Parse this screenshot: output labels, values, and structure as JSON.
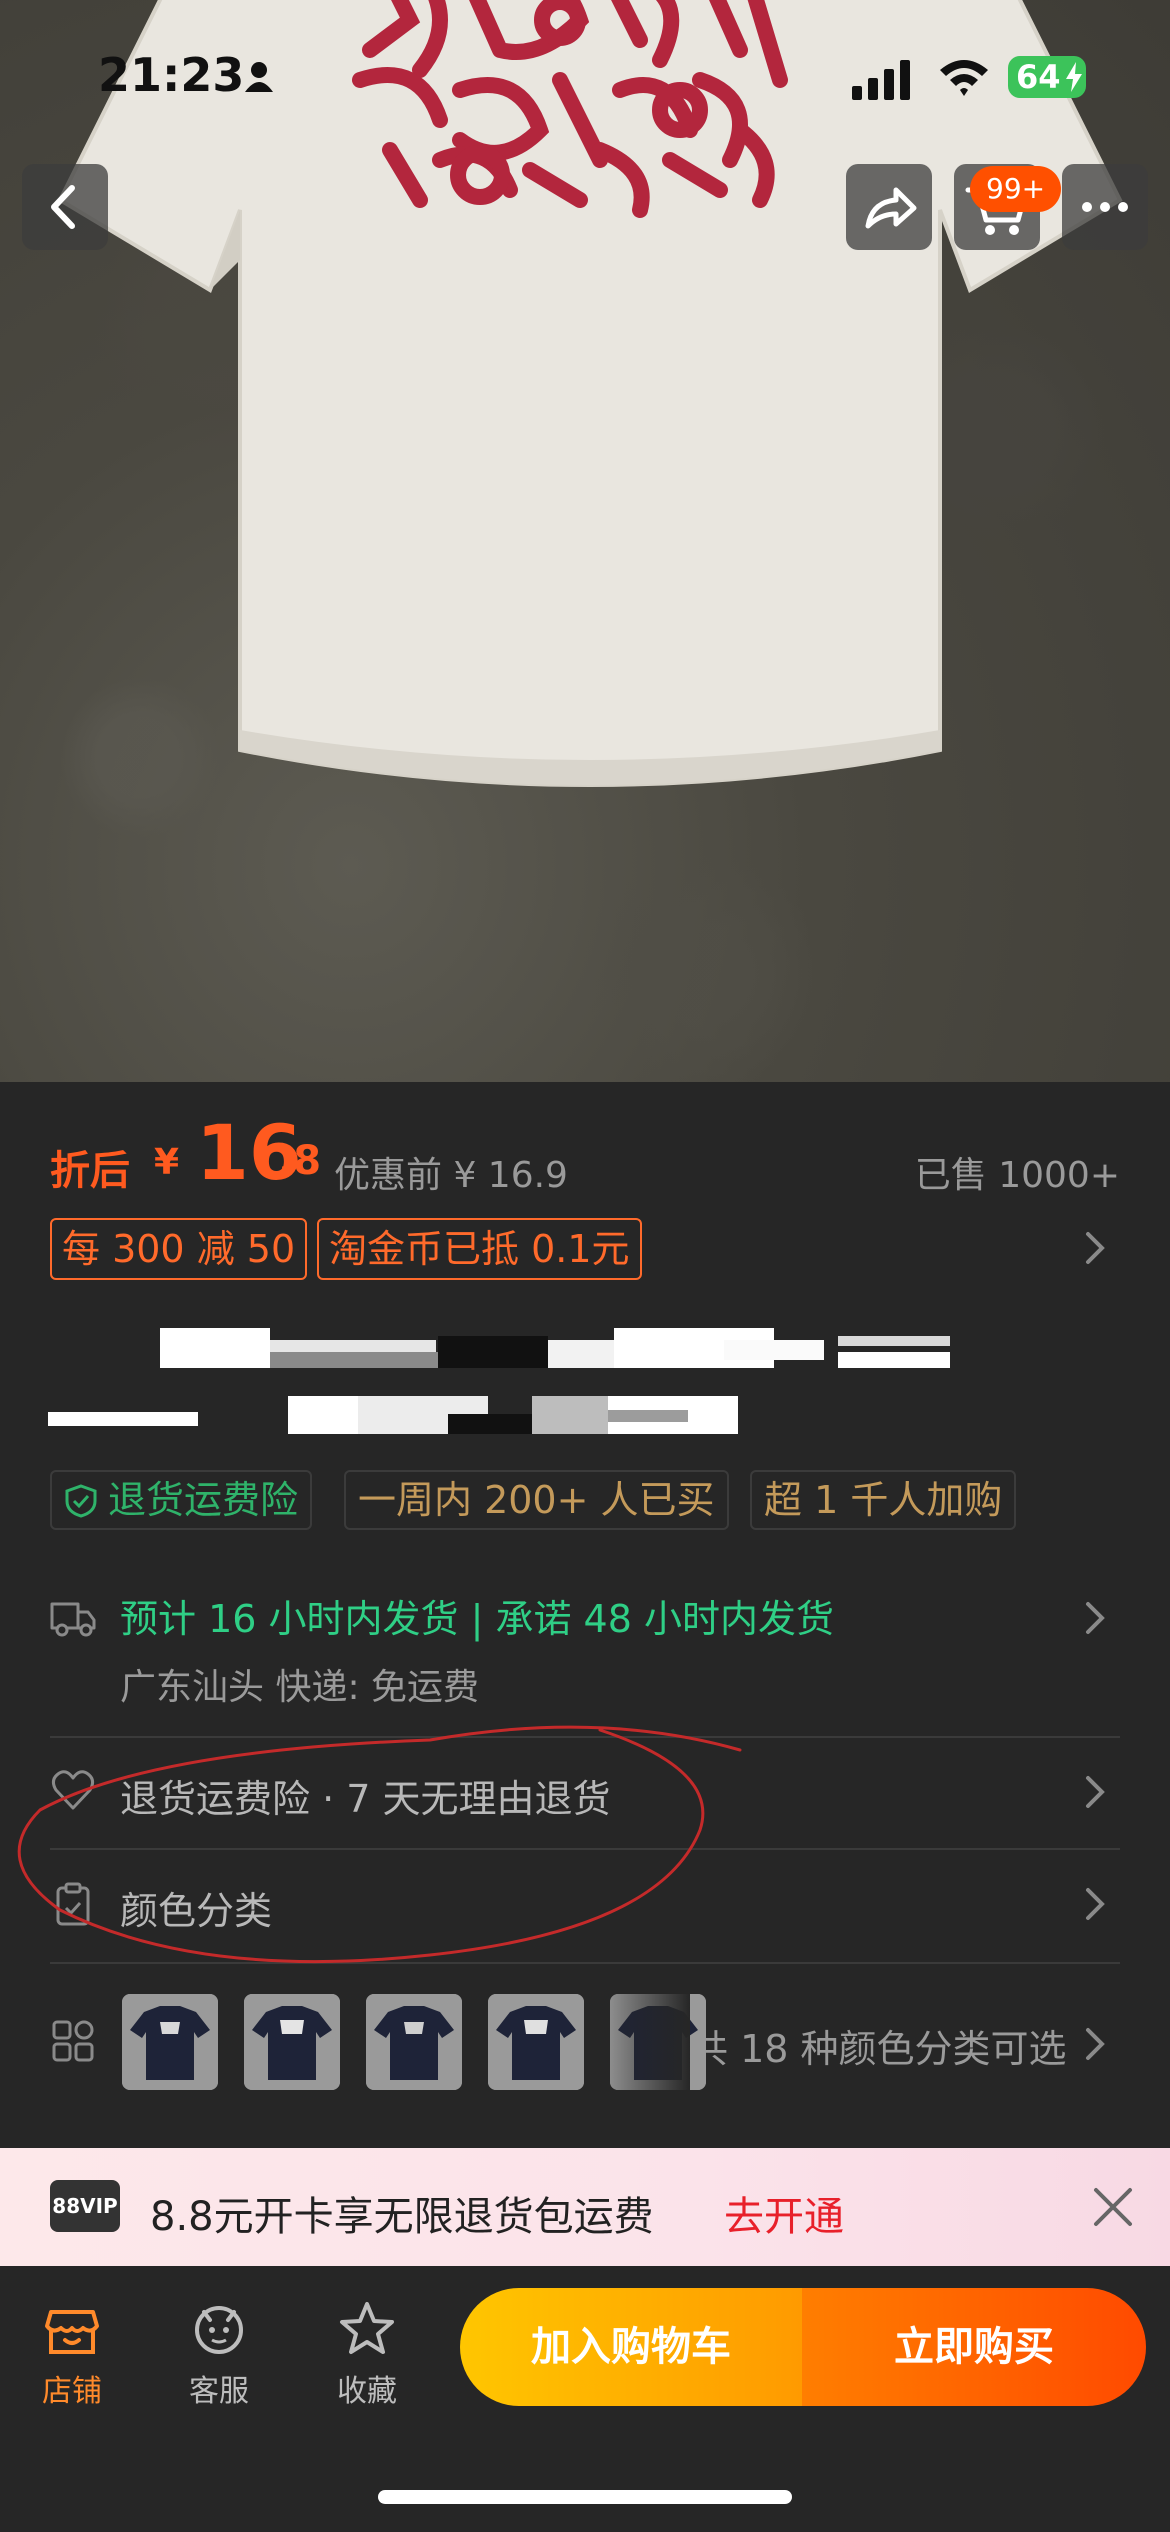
{
  "status_bar": {
    "time": "21:23",
    "battery": "64"
  },
  "nav": {
    "cart_badge": "99+"
  },
  "price": {
    "prefix": "折后",
    "currency": "¥",
    "integer": "16",
    "decimal": ".8",
    "before_label": "优惠前 ¥ 16.9",
    "sold": "已售 1000+"
  },
  "coupons": [
    "每 300 减 50",
    "淘金币已抵 0.1元"
  ],
  "tags": [
    "退货运费险",
    "一周内 200+ 人已买",
    "超 1 千人加购"
  ],
  "shipping": {
    "main": "预计 16 小时内发货 | 承诺 48 小时内发货",
    "sub": "广东汕头  快递: 免运费"
  },
  "service": {
    "label": "退货运费险 · 7 天无理由退货"
  },
  "variant": {
    "label": "颜色分类"
  },
  "colors": {
    "count_label": "共 18 种颜色分类可选"
  },
  "vip": {
    "badge": "88VIP",
    "text": "8.8元开卡享无限退货包运费",
    "link": "去开通"
  },
  "tabs": {
    "shop": "店铺",
    "service": "客服",
    "favorite": "收藏"
  },
  "actions": {
    "add_to_cart": "加入购物车",
    "buy_now": "立即购买"
  },
  "colors_theme": {
    "accent": "#ff5a1f",
    "green": "#2fcf86",
    "panel": "#262626"
  }
}
